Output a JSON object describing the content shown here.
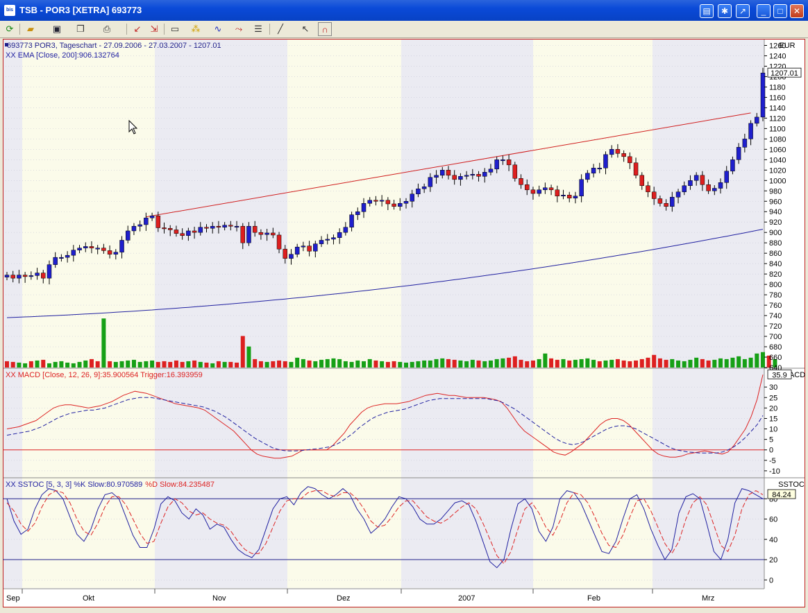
{
  "window": {
    "title": "TSB - POR3 [XETRA] 693773",
    "app_icon": "bis"
  },
  "toolbar": {
    "icons": [
      "refresh-icon",
      "open-folder-icon",
      "save-icon",
      "copy-icon",
      "print-icon",
      "draw-line-icon",
      "zoom-icon",
      "chart-type-icon",
      "indicator-icon",
      "studies-icon",
      "trend-icon",
      "properties-icon",
      "line-tool-icon",
      "cursor-icon",
      "magnet-icon"
    ]
  },
  "chart_data": [
    {
      "type": "candlestick",
      "title": "693773  POR3, Tageschart - 27.09.2006 - 27.03.2007 - 1207.01",
      "subtitle": "XX EMA [Close, 200]:906.132764",
      "currency_label": "EUR",
      "last_price_label": "1207.01",
      "ylim": [
        640,
        1270
      ],
      "y_ticks": [
        1260,
        1240,
        1220,
        1200,
        1180,
        1160,
        1140,
        1120,
        1100,
        1080,
        1060,
        1040,
        1020,
        1000,
        980,
        960,
        940,
        920,
        900,
        880,
        860,
        840,
        820,
        800,
        780,
        760,
        740,
        720,
        700,
        680,
        660,
        640
      ],
      "x_labels": [
        "Sep",
        "Okt",
        "Nov",
        "Dez",
        "2007",
        "Feb",
        "Mrz"
      ],
      "colors": {
        "up": "#1f1fcc",
        "down": "#dd1f1f",
        "ema": "#1f1fa0",
        "trendline": "#d01c1c",
        "volume_up": "#16a016",
        "volume_down": "#dd2020"
      },
      "closes": [
        818,
        812,
        818,
        815,
        817,
        822,
        812,
        838,
        852,
        852,
        856,
        866,
        870,
        873,
        870,
        870,
        865,
        858,
        862,
        885,
        903,
        912,
        915,
        928,
        932,
        909,
        908,
        905,
        898,
        894,
        903,
        900,
        910,
        908,
        912,
        910,
        914,
        912,
        912,
        880,
        912,
        900,
        896,
        899,
        895,
        868,
        850,
        858,
        872,
        874,
        864,
        878,
        885,
        887,
        890,
        900,
        910,
        934,
        940,
        956,
        962,
        960,
        962,
        955,
        950,
        956,
        960,
        974,
        984,
        988,
        1006,
        1010,
        1020,
        1010,
        1002,
        1008,
        1010,
        1012,
        1008,
        1016,
        1022,
        1040,
        1040,
        1030,
        1004,
        992,
        982,
        975,
        982,
        986,
        982,
        970,
        972,
        966,
        970,
        1002,
        1014,
        1024,
        1024,
        1050,
        1060,
        1052,
        1046,
        1034,
        1010,
        990,
        978,
        965,
        956,
        950,
        968,
        978,
        990,
        1000,
        1010,
        992,
        980,
        985,
        996,
        1018,
        1040,
        1064,
        1080,
        1110,
        1122,
        1207.01
      ],
      "ema_start": 736,
      "ema_end": 906.13,
      "trendline": {
        "from": [
          23,
          930
        ],
        "to": [
          123,
          1130
        ]
      },
      "volumes": [
        9,
        8,
        7,
        6,
        9,
        10,
        11,
        6,
        8,
        9,
        7,
        6,
        8,
        10,
        12,
        9,
        70,
        9,
        8,
        9,
        10,
        11,
        8,
        9,
        10,
        8,
        9,
        8,
        10,
        8,
        9,
        10,
        8,
        7,
        6,
        9,
        8,
        8,
        7,
        45,
        30,
        12,
        9,
        8,
        9,
        10,
        9,
        8,
        14,
        12,
        10,
        9,
        11,
        12,
        13,
        12,
        9,
        8,
        10,
        9,
        12,
        10,
        9,
        8,
        9,
        8,
        7,
        8,
        9,
        10,
        10,
        12,
        13,
        12,
        11,
        10,
        9,
        11,
        10,
        9,
        10,
        12,
        13,
        14,
        16,
        11,
        9,
        10,
        12,
        20,
        13,
        11,
        12,
        10,
        11,
        12,
        13,
        11,
        9,
        10,
        11,
        12,
        10,
        9,
        10,
        12,
        14,
        18,
        13,
        11,
        12,
        10,
        9,
        11,
        14,
        12,
        10,
        11,
        13,
        12,
        14,
        16,
        12,
        14,
        20,
        22,
        17,
        12
      ],
      "volume_up": [
        0,
        0,
        1,
        1,
        0,
        1,
        0,
        1,
        1,
        1,
        1,
        1,
        1,
        1,
        0,
        0,
        1,
        0,
        1,
        1,
        1,
        1,
        1,
        1,
        1,
        0,
        0,
        0,
        0,
        0,
        1,
        0,
        1,
        0,
        1,
        0,
        1,
        0,
        0,
        0,
        1,
        0,
        0,
        1,
        0,
        0,
        0,
        1,
        1,
        1,
        0,
        1,
        1,
        1,
        1,
        1,
        1,
        1,
        1,
        1,
        1,
        0,
        1,
        0,
        0,
        1,
        1,
        1,
        1,
        1,
        1,
        1,
        1,
        0,
        0,
        1,
        1,
        1,
        0,
        1,
        1,
        1,
        1,
        0,
        0,
        0,
        0,
        0,
        1,
        1,
        0,
        0,
        1,
        0,
        1,
        1,
        1,
        1,
        0,
        1,
        1,
        0,
        0,
        0,
        0,
        0,
        0,
        0,
        0,
        0,
        1,
        1,
        1,
        1,
        1,
        0,
        0,
        1,
        1,
        1,
        1,
        1,
        1,
        1,
        1,
        1,
        0,
        1
      ]
    },
    {
      "type": "line",
      "title": "XX MACD [Close, 12, 26, 9]:35.900564  Trigger:16.393959",
      "panel_label": "MACD",
      "last_value_label": "35.9",
      "ylim": [
        -13,
        38
      ],
      "y_ticks": [
        30,
        25,
        20,
        15,
        10,
        5,
        0,
        -5,
        -10
      ],
      "series": [
        {
          "name": "MACD",
          "color": "#dd2222",
          "dash": false,
          "values": [
            10,
            10.5,
            11,
            12,
            13,
            14,
            16,
            18,
            20,
            21,
            21.5,
            21.5,
            21,
            20.5,
            20,
            20.5,
            21,
            22,
            23,
            24.5,
            26,
            27,
            28,
            27.5,
            27,
            26,
            25,
            24,
            23,
            22,
            21.5,
            21,
            20.5,
            20,
            19,
            17,
            15,
            13,
            11,
            9,
            6,
            3,
            0,
            -2,
            -3,
            -3.5,
            -4,
            -4,
            -3.5,
            -3,
            -1.5,
            0,
            0,
            0,
            0,
            0,
            2,
            5,
            8,
            12,
            15,
            18,
            20,
            21,
            21.5,
            22,
            22,
            22,
            22.5,
            23,
            24,
            25,
            26,
            26.5,
            27,
            26.5,
            26,
            26,
            25.5,
            25,
            25,
            25,
            25,
            24.5,
            24,
            23,
            20,
            16,
            12,
            9,
            7,
            5,
            3,
            1,
            -1,
            -2,
            -2.5,
            -1,
            1,
            3,
            6,
            9,
            12,
            14,
            15,
            15,
            14,
            12,
            9,
            6,
            3,
            0,
            -2,
            -3,
            -3.5,
            -3.5,
            -3,
            -2,
            -1.5,
            -1,
            -0.5,
            -1,
            -1.5,
            -2,
            -1,
            2,
            6,
            10,
            16,
            24,
            35.9
          ]
        },
        {
          "name": "Trigger",
          "color": "#1f1fa0",
          "dash": true,
          "values": [
            7,
            7.5,
            8,
            8.5,
            9,
            10,
            11,
            12.5,
            14,
            15.5,
            16.5,
            17.5,
            18,
            18.5,
            19,
            19,
            19.5,
            20,
            21,
            22,
            23,
            24,
            24.5,
            25,
            25,
            25,
            24.5,
            24,
            23.5,
            23,
            22.5,
            22,
            21.5,
            21,
            20.5,
            19.5,
            18.5,
            17,
            15.5,
            13.5,
            11.5,
            9.5,
            7.5,
            5.5,
            4,
            2.5,
            1,
            0.2,
            -0.3,
            -0.5,
            -0.5,
            -0.3,
            0,
            0.3,
            0.6,
            1,
            1.5,
            2.5,
            4,
            6,
            8,
            10.5,
            12.5,
            14.5,
            16,
            17,
            18,
            18.5,
            19,
            19.5,
            20.5,
            21.5,
            22.5,
            23.5,
            24,
            24.5,
            24.5,
            24.5,
            24.5,
            24.5,
            24.5,
            24.5,
            24.5,
            24.5,
            24,
            23.5,
            22.5,
            21,
            19.5,
            17.5,
            15.5,
            13.5,
            11.5,
            9.5,
            7.5,
            5.5,
            4,
            3,
            2.5,
            3,
            4,
            5.5,
            7,
            8.5,
            10,
            11,
            11.5,
            11.5,
            11,
            10,
            8.5,
            7,
            5.5,
            4,
            2.5,
            1,
            0,
            -0.5,
            -1,
            -1.2,
            -1.5,
            -1.5,
            -1.5,
            -1.5,
            -1,
            0,
            1.5,
            3.5,
            6,
            9,
            12,
            16.4
          ]
        },
        {
          "name": "",
          "color": "#dd2222",
          "dash": false,
          "values_const": 0
        }
      ]
    },
    {
      "type": "line",
      "title_prefix": "XX SSTOC [5, 3, 3] %K Slow:80.970589",
      "title_suffix": "%D Slow:84.235487",
      "panel_label": "SSTOC",
      "last_value_label": "84.24",
      "ylim": [
        -8,
        100
      ],
      "y_ticks": [
        80,
        60,
        40,
        20,
        0
      ],
      "hlines": [
        80,
        20
      ],
      "series": [
        {
          "name": "%K Slow",
          "color": "#1f1fa0",
          "dash": false,
          "values": [
            80,
            58,
            45,
            50,
            70,
            84,
            90,
            88,
            80,
            62,
            45,
            38,
            50,
            70,
            84,
            86,
            80,
            62,
            44,
            32,
            32,
            50,
            75,
            82,
            78,
            66,
            60,
            70,
            64,
            50,
            55,
            52,
            40,
            30,
            25,
            22,
            30,
            50,
            70,
            80,
            82,
            74,
            86,
            92,
            90,
            84,
            80,
            84,
            90,
            84,
            70,
            60,
            46,
            52,
            60,
            72,
            82,
            80,
            72,
            60,
            55,
            55,
            60,
            68,
            76,
            78,
            74,
            58,
            38,
            18,
            12,
            20,
            50,
            75,
            80,
            70,
            48,
            38,
            52,
            80,
            88,
            86,
            76,
            60,
            44,
            28,
            26,
            38,
            60,
            80,
            84,
            70,
            50,
            34,
            20,
            30,
            66,
            82,
            85,
            80,
            55,
            28,
            20,
            40,
            76,
            90,
            88,
            84,
            80
          ]
        },
        {
          "name": "%D Slow",
          "color": "#dd2222",
          "dash": true,
          "values": [
            76,
            68,
            55,
            48,
            56,
            72,
            84,
            88,
            86,
            76,
            60,
            48,
            44,
            56,
            72,
            82,
            82,
            74,
            60,
            46,
            36,
            38,
            56,
            72,
            80,
            76,
            68,
            64,
            66,
            60,
            56,
            54,
            48,
            38,
            30,
            26,
            26,
            36,
            52,
            68,
            78,
            80,
            80,
            86,
            88,
            88,
            84,
            82,
            86,
            86,
            80,
            70,
            58,
            52,
            54,
            62,
            72,
            78,
            78,
            70,
            62,
            58,
            56,
            60,
            66,
            72,
            76,
            70,
            56,
            40,
            24,
            16,
            28,
            50,
            70,
            76,
            66,
            52,
            44,
            58,
            76,
            86,
            84,
            76,
            62,
            46,
            34,
            32,
            44,
            62,
            78,
            80,
            68,
            52,
            36,
            26,
            38,
            60,
            76,
            82,
            74,
            54,
            34,
            28,
            44,
            70,
            84,
            88,
            84
          ]
        }
      ]
    }
  ]
}
